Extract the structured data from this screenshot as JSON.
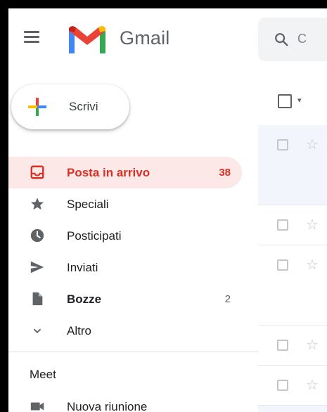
{
  "app": {
    "name": "Gmail"
  },
  "search": {
    "placeholder_visible": "C"
  },
  "compose": {
    "label": "Scrivi"
  },
  "nav": [
    {
      "label": "Posta in arrivo",
      "count": "38",
      "icon": "inbox-icon",
      "active": true
    },
    {
      "label": "Speciali",
      "count": "",
      "icon": "star-icon"
    },
    {
      "label": "Posticipati",
      "count": "",
      "icon": "clock-icon"
    },
    {
      "label": "Inviati",
      "count": "",
      "icon": "send-icon"
    },
    {
      "label": "Bozze",
      "count": "2",
      "icon": "draft-icon",
      "bold": true
    },
    {
      "label": "Altro",
      "count": "",
      "icon": "chevron-down-icon"
    }
  ],
  "meet": {
    "title": "Meet",
    "items": [
      {
        "label": "Nuova riunione",
        "icon": "video-camera-icon"
      }
    ]
  },
  "colors": {
    "active_bg": "#fce8e6",
    "active_text": "#d93025",
    "search_bg": "#f1f3f4",
    "gmail_red": "#ea4335",
    "gmail_blue": "#4285f4",
    "gmail_green": "#34a853",
    "gmail_yellow": "#fbbc04"
  }
}
